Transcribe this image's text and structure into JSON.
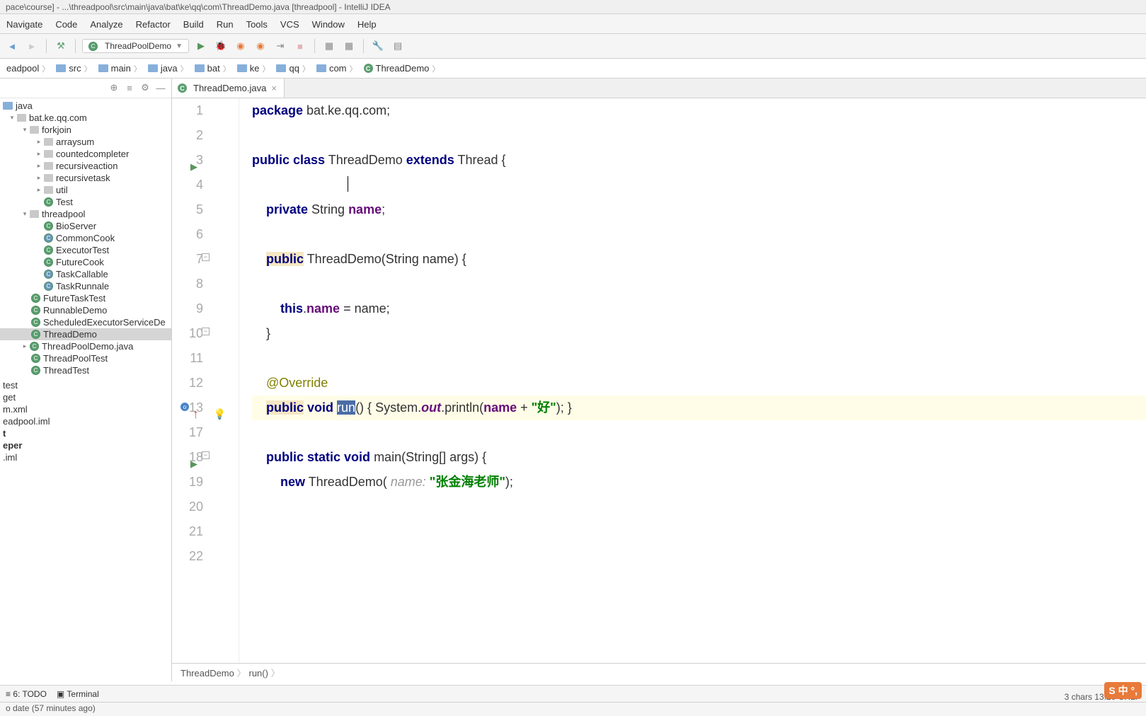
{
  "window_title": "pace\\course] - ...\\threadpool\\src\\main\\java\\bat\\ke\\qq\\com\\ThreadDemo.java [threadpool] - IntelliJ IDEA",
  "menu": [
    "Navigate",
    "Code",
    "Analyze",
    "Refactor",
    "Build",
    "Run",
    "Tools",
    "VCS",
    "Window",
    "Help"
  ],
  "run_config": "ThreadPoolDemo",
  "breadcrumb": [
    "eadpool",
    "src",
    "main",
    "java",
    "bat",
    "ke",
    "qq",
    "com",
    "ThreadDemo"
  ],
  "tabs": [
    {
      "name": "ThreadDemo.java"
    }
  ],
  "tree": {
    "root": "java",
    "pkg": "bat.ke.qq.com",
    "forkjoin": "forkjoin",
    "forkjoin_children": [
      "arraysum",
      "countedcompleter",
      "recursiveaction",
      "recursivetask",
      "util"
    ],
    "test": "Test",
    "threadpool": "threadpool",
    "tp_children": [
      "BioServer",
      "CommonCook",
      "ExecutorTest",
      "FutureCook",
      "TaskCallable",
      "TaskRunnale"
    ],
    "siblings": [
      "FutureTaskTest",
      "RunnableDemo",
      "ScheduledExecutorServiceDe",
      "ThreadDemo",
      "ThreadPoolDemo.java",
      "ThreadPoolTest",
      "ThreadTest"
    ],
    "bottom": [
      "test",
      "get",
      "m.xml",
      "eadpool.iml",
      "t",
      "eper",
      ".iml"
    ]
  },
  "code": {
    "l1a": "package",
    "l1b": " bat.ke.qq.com;",
    "l3a": "public",
    "l3b": " class",
    "l3c": " ThreadDemo ",
    "l3d": "extends",
    "l3e": " Thread {",
    "l5a": "    private",
    "l5b": " String ",
    "l5c": "name",
    "l5d": ";",
    "l7a": "    ",
    "l7b": "public",
    "l7c": " ThreadDemo(String name) {",
    "l9a": "        this",
    "l9b": ".",
    "l9c": "name",
    "l9d": " = name;",
    "l10": "    }",
    "l12a": "    ",
    "l12b": "@Override",
    "l13a": "    ",
    "l13b": "public",
    "l13c": " void",
    "l13d": " ",
    "l13e": "run",
    "l13f": "() { System.",
    "l13g": "out",
    "l13h": ".println(",
    "l13i": "name",
    "l13j": " + ",
    "l13k": "\"好\"",
    "l13l": "); }",
    "l18a": "    public",
    "l18b": " static",
    "l18c": " void",
    "l18d": " main(String[] args) {",
    "l19a": "        new",
    "l19b": " ThreadDemo( ",
    "l19c": "name:",
    "l19d": " ",
    "l19e": "\"张金海老师\"",
    "l19f": ");"
  },
  "gutter": [
    "1",
    "2",
    "3",
    "4",
    "5",
    "6",
    "7",
    "8",
    "9",
    "10",
    "11",
    "12",
    "13",
    "17",
    "18",
    "19",
    "20",
    "21",
    "22"
  ],
  "crumbline": [
    "ThreadDemo",
    "run()"
  ],
  "statusbar": {
    "todo": "6: TODO",
    "terminal": "Terminal",
    "right": "3 chars   13:20   CRLF",
    "bottom": "o date (57 minutes ago)"
  },
  "corner": "S 中 °,"
}
